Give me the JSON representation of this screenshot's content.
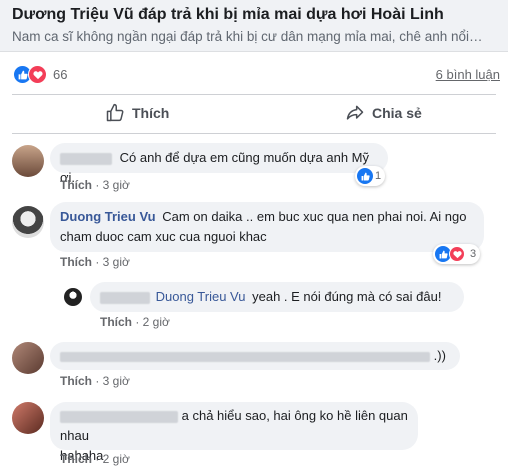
{
  "link": {
    "title": "Dương Triệu Vũ đáp trả khi bị mỉa mai dựa hơi Hoài Linh",
    "description": "Nam ca sĩ không ngần ngại đáp trả khi bị cư dân mạng mỉa mai, chê anh nổi…"
  },
  "stats": {
    "reaction_count": "66",
    "comments_label": "6 bình luận",
    "reactions": [
      "like-icon",
      "love-icon"
    ]
  },
  "actions": {
    "like_label": "Thích",
    "share_label": "Chia sẻ"
  },
  "comments": [
    {
      "text": "Có anh để dựa em cũng muốn dựa anh Mỹ ơi.",
      "like_label": "Thích",
      "time": "3 giờ",
      "reaction_count": "1"
    },
    {
      "author": "Duong Trieu Vu",
      "text_line1": "Cam on daika .. em buc xuc qua nen phai noi. Ai ngo",
      "text_line2": "cham duoc cam xuc cua nguoi khac",
      "like_label": "Thích",
      "time": "3 giờ",
      "reaction_count": "3"
    },
    {
      "mention": "Duong Trieu Vu",
      "text": "yeah . E nói đúng mà có sai đâu!",
      "like_label": "Thích",
      "time": "2 giờ"
    },
    {
      "text": ".))",
      "like_label": "Thích",
      "time": "3 giờ"
    },
    {
      "text_line1": "a chả hiểu sao, hai ông ko hề liên quan nhau",
      "text_line2": "hahaha",
      "like_label": "Thích",
      "time": "2 giờ"
    }
  ],
  "colors": {
    "brand_blue": "#1877f2",
    "love_red": "#f33e58",
    "name_blue": "#385898",
    "bubble_bg": "#f0f2f5"
  }
}
